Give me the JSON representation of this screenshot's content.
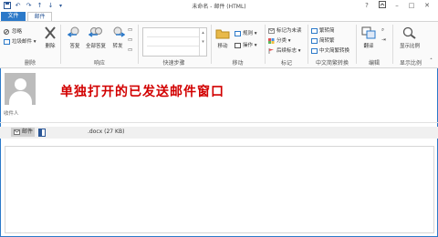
{
  "window": {
    "title": "未命名 - 邮件 (HTML)",
    "help": "?"
  },
  "quick_access": {
    "save_icon": "save-icon",
    "undo_icon": "undo-icon",
    "redo_icon": "redo-icon",
    "up_icon": "up-arrow-icon",
    "down_icon": "down-arrow-icon"
  },
  "tabs": [
    {
      "label": "文件"
    },
    {
      "label": "邮件"
    }
  ],
  "ribbon": {
    "delete_group": {
      "label": "删除",
      "ignore": "忽略",
      "junk": "垃圾邮件 ▾",
      "delete": "删除"
    },
    "respond_group": {
      "label": "响应",
      "reply": "答复",
      "reply_all": "全部答复",
      "forward": "转发"
    },
    "quick_steps_group": {
      "label": "快速步骤"
    },
    "move_group": {
      "label": "移动",
      "move": "移动",
      "rules": "规则 ▾",
      "actions": "操作 ▾"
    },
    "tags_group": {
      "label": "标记",
      "mark_unread": "标记为未读",
      "categorize": "分类 ▾",
      "follow_up": "后续标志 ▾"
    },
    "chinese_group": {
      "label": "中文简繁转换",
      "to_simplified": "繁转简",
      "to_traditional": "简转繁",
      "convert": "中文简繁转换"
    },
    "editing_group": {
      "label": "编辑",
      "translate": "翻译"
    },
    "zoom_group": {
      "label": "显示比例",
      "zoom": "显示比例"
    }
  },
  "header": {
    "annotation": "单独打开的已发送邮件窗口",
    "recipient_label": "收件人"
  },
  "attachments": {
    "message": "邮件",
    "file": ".docx (27 KB)"
  }
}
